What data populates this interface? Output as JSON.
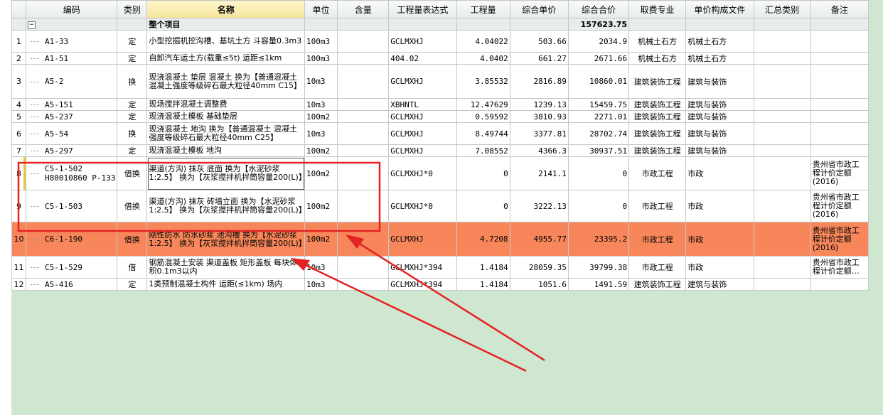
{
  "columns": [
    "",
    "编码",
    "类别",
    "名称",
    "单位",
    "含量",
    "工程量表达式",
    "工程量",
    "综合单价",
    "综合合价",
    "取费专业",
    "单价构成文件",
    "汇总类别",
    "备注"
  ],
  "summary": {
    "toggle": "−",
    "name": "整个项目",
    "total": "157623.75"
  },
  "rows": [
    {
      "no": "1",
      "code": "A1-33",
      "code2": "",
      "type": "定",
      "name": "小型挖掘机挖沟槽、基坑土方 斗容量0.3m3",
      "unit": "100m3",
      "content": "",
      "expr": "GCLMXHJ",
      "qty": "4.04022",
      "price": "503.66",
      "total": "2034.9",
      "fee": "机械土石方",
      "file": "机械土石方",
      "cat": "",
      "note": ""
    },
    {
      "no": "2",
      "code": "A1-51",
      "code2": "",
      "type": "定",
      "name": "自卸汽车运土方(载重≤5t) 运距≤1km",
      "unit": "100m3",
      "content": "",
      "expr": "404.02",
      "qty": "4.0402",
      "price": "661.27",
      "total": "2671.66",
      "fee": "机械土石方",
      "file": "机械土石方",
      "cat": "",
      "note": ""
    },
    {
      "no": "3",
      "code": "A5-2",
      "code2": "",
      "type": "换",
      "name": "现浇混凝土 垫层 混凝土  换为【普通混凝土 混凝土强度等级碎石最大粒径40mm C15】",
      "unit": "10m3",
      "content": "",
      "expr": "GCLMXHJ",
      "qty": "3.85532",
      "price": "2816.89",
      "total": "10860.01",
      "fee": "建筑装饰工程",
      "file": "建筑与装饰",
      "cat": "",
      "note": ""
    },
    {
      "no": "4",
      "code": "A5-151",
      "code2": "",
      "type": "定",
      "name": "现场搅拌混凝土调整费",
      "unit": "10m3",
      "content": "",
      "expr": "XBHNTL",
      "qty": "12.47629",
      "price": "1239.13",
      "total": "15459.75",
      "fee": "建筑装饰工程",
      "file": "建筑与装饰",
      "cat": "",
      "note": ""
    },
    {
      "no": "5",
      "code": "A5-237",
      "code2": "",
      "type": "定",
      "name": "现浇混凝土模板 基础垫层",
      "unit": "100m2",
      "content": "",
      "expr": "GCLMXHJ",
      "qty": "0.59592",
      "price": "3810.93",
      "total": "2271.01",
      "fee": "建筑装饰工程",
      "file": "建筑与装饰",
      "cat": "",
      "note": ""
    },
    {
      "no": "6",
      "code": "A5-54",
      "code2": "",
      "type": "换",
      "name": "现浇混凝土 地沟  换为【普通混凝土 混凝土强度等级碎石最大粒径40mm C25】",
      "unit": "10m3",
      "content": "",
      "expr": "GCLMXHJ",
      "qty": "8.49744",
      "price": "3377.81",
      "total": "28702.74",
      "fee": "建筑装饰工程",
      "file": "建筑与装饰",
      "cat": "",
      "note": ""
    },
    {
      "no": "7",
      "code": "A5-297",
      "code2": "",
      "type": "定",
      "name": "现浇混凝土模板 地沟",
      "unit": "100m2",
      "content": "",
      "expr": "GCLMXHJ",
      "qty": "7.08552",
      "price": "4366.3",
      "total": "30937.51",
      "fee": "建筑装饰工程",
      "file": "建筑与装饰",
      "cat": "",
      "note": ""
    },
    {
      "no": "8",
      "code": "C5-1-502",
      "code2": "H80010860 P-133",
      "type": "借换",
      "name": "渠道(方沟) 抹灰 底面  换为【水泥砂浆 1:2.5】  换为【灰浆搅拌机拌筒容量200(L)】",
      "unit": "100m2",
      "content": "",
      "expr": "GCLMXHJ*0",
      "qty": "0",
      "price": "2141.1",
      "total": "0",
      "fee": "市政工程",
      "file": "市政",
      "cat": "",
      "note": "贵州省市政工程计价定额(2016)"
    },
    {
      "no": "9",
      "code": "C5-1-503",
      "code2": "",
      "type": "借换",
      "name": "渠道(方沟) 抹灰 砖墙立面  换为【水泥砂浆 1:2.5】  换为【灰浆搅拌机拌筒容量200(L)】",
      "unit": "100m2",
      "content": "",
      "expr": "GCLMXHJ*0",
      "qty": "0",
      "price": "3222.13",
      "total": "0",
      "fee": "市政工程",
      "file": "市政",
      "cat": "",
      "note": "贵州省市政工程计价定额(2016)"
    },
    {
      "no": "10",
      "code": "C6-1-190",
      "code2": "",
      "type": "借换",
      "name": "刚性防水 防水砂浆 池沟槽  换为【水泥砂浆 1:2.5】  换为【灰浆搅拌机拌筒容量200(L)】",
      "unit": "100m2",
      "content": "",
      "expr": "GCLMXHJ",
      "qty": "4.7208",
      "price": "4955.77",
      "total": "23395.2",
      "fee": "市政工程",
      "file": "市政",
      "cat": "",
      "note": "贵州省市政工程计价定额(2016)"
    },
    {
      "no": "11",
      "code": "C5-1-529",
      "code2": "",
      "type": "借",
      "name": "钢筋混凝土安装 渠道盖板 矩形盖板 每块体积0.1m3以内",
      "unit": "10m3",
      "content": "",
      "expr": "GCLMXHJ*394",
      "qty": "1.4184",
      "price": "28059.35",
      "total": "39799.38",
      "fee": "市政工程",
      "file": "市政",
      "cat": "",
      "note": "贵州省市政工程计价定额…"
    },
    {
      "no": "12",
      "code": "A5-416",
      "code2": "",
      "type": "定",
      "name": "1类预制混凝土构件 运距(≤1km) 场内",
      "unit": "10m3",
      "content": "",
      "expr": "GCLMXHJ*394",
      "qty": "1.4184",
      "price": "1051.6",
      "total": "1491.59",
      "fee": "建筑装饰工程",
      "file": "建筑与装饰",
      "cat": "",
      "note": ""
    }
  ],
  "colors": {
    "highlight_row": "#f7875a",
    "annotation": "#e52222",
    "background": "#cfe6d0"
  }
}
